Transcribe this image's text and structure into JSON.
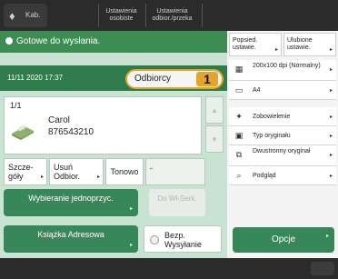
{
  "topbar": {
    "home_label": "Kab.",
    "personal_settings": "Ustawienia osobiste",
    "shared_settings": "Ustawienia odbior./przeka"
  },
  "status": {
    "text": "Gotowe do wysłania."
  },
  "main": {
    "datetime": "11/11 2020 17:37",
    "recipient_label": "Odbiorcy",
    "recipient_count": "1",
    "list": {
      "counter": "1/1",
      "entry_name": "Carol",
      "entry_number": "876543210"
    },
    "buttons": {
      "details": "Szcze-góły",
      "remove": "Usuń Odbior.",
      "tone": "Tonowo",
      "select_single": "Wybieranie jednoprzyc.",
      "destinations": "Do Wł-Serk.",
      "address_book": "Książka Adresowa",
      "direct_send": "Bezp. Wysyłanie"
    }
  },
  "right": {
    "tabs": {
      "favorites": "Popsied. ustawie.",
      "common": "Ulubione ustawie."
    },
    "settings": [
      {
        "icon": "resolution-icon",
        "label": "200x100 dpi (Normalny)"
      },
      {
        "icon": "paper-icon",
        "label": "A4"
      },
      {
        "icon": "density-icon",
        "label": "Zobowielenie"
      },
      {
        "icon": "original-type-icon",
        "label": "Typ oryginału"
      },
      {
        "icon": "duplex-icon",
        "label": "Dwustronny oryginał"
      },
      {
        "icon": "preview-icon",
        "label": "Podgląd"
      }
    ],
    "options": "Opcje"
  }
}
